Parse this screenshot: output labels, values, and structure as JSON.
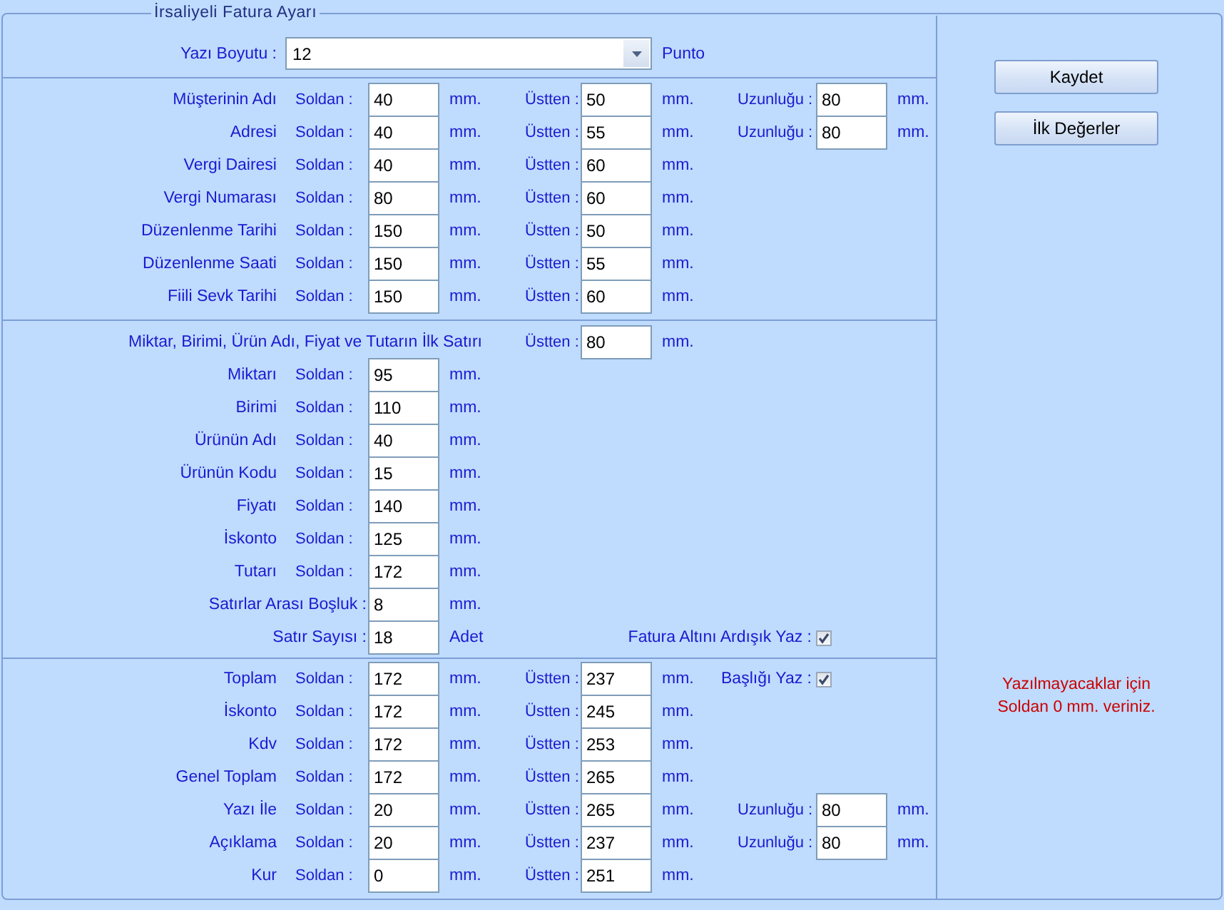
{
  "group_title": "İrsaliyeli Fatura Ayarı",
  "font_size": {
    "label": "Yazı Boyutu :",
    "value": "12",
    "unit": "Punto"
  },
  "sections": [
    {
      "rows": [
        {
          "kind": "row",
          "label": "Müşterinin Adı",
          "left": {
            "label": "Soldan :",
            "value": "40",
            "unit": "mm."
          },
          "top": {
            "label": "Üstten :",
            "value": "50",
            "unit": "mm."
          },
          "length": {
            "label": "Uzunluğu :",
            "value": "80",
            "unit": "mm."
          }
        },
        {
          "kind": "row",
          "label": "Adresi",
          "left": {
            "label": "Soldan :",
            "value": "40",
            "unit": "mm."
          },
          "top": {
            "label": "Üstten :",
            "value": "55",
            "unit": "mm."
          },
          "length": {
            "label": "Uzunluğu :",
            "value": "80",
            "unit": "mm."
          }
        },
        {
          "kind": "row",
          "label": "Vergi Dairesi",
          "left": {
            "label": "Soldan :",
            "value": "40",
            "unit": "mm."
          },
          "top": {
            "label": "Üstten :",
            "value": "60",
            "unit": "mm."
          }
        },
        {
          "kind": "row",
          "label": "Vergi Numarası",
          "left": {
            "label": "Soldan :",
            "value": "80",
            "unit": "mm."
          },
          "top": {
            "label": "Üstten :",
            "value": "60",
            "unit": "mm."
          }
        },
        {
          "kind": "row",
          "label": "Düzenlenme Tarihi",
          "left": {
            "label": "Soldan :",
            "value": "150",
            "unit": "mm."
          },
          "top": {
            "label": "Üstten :",
            "value": "50",
            "unit": "mm."
          }
        },
        {
          "kind": "row",
          "label": "Düzenlenme Saati",
          "left": {
            "label": "Soldan :",
            "value": "150",
            "unit": "mm."
          },
          "top": {
            "label": "Üstten :",
            "value": "55",
            "unit": "mm."
          }
        },
        {
          "kind": "row",
          "label": "Fiili Sevk Tarihi",
          "left": {
            "label": "Soldan :",
            "value": "150",
            "unit": "mm."
          },
          "top": {
            "label": "Üstten :",
            "value": "60",
            "unit": "mm."
          }
        }
      ]
    },
    {
      "rows": [
        {
          "kind": "heading",
          "label": "Miktar, Birimi, Ürün Adı, Fiyat ve Tutarın İlk Satırı",
          "top": {
            "label": "Üstten :",
            "value": "80",
            "unit": "mm."
          }
        },
        {
          "kind": "row",
          "label": "Miktarı",
          "left": {
            "label": "Soldan :",
            "value": "95",
            "unit": "mm."
          }
        },
        {
          "kind": "row",
          "label": "Birimi",
          "left": {
            "label": "Soldan :",
            "value": "110",
            "unit": "mm."
          }
        },
        {
          "kind": "row",
          "label": "Ürünün Adı",
          "left": {
            "label": "Soldan :",
            "value": "40",
            "unit": "mm."
          }
        },
        {
          "kind": "row",
          "label": "Ürünün Kodu",
          "left": {
            "label": "Soldan :",
            "value": "15",
            "unit": "mm."
          }
        },
        {
          "kind": "row",
          "label": "Fiyatı",
          "left": {
            "label": "Soldan :",
            "value": "140",
            "unit": "mm."
          }
        },
        {
          "kind": "row",
          "label": "İskonto",
          "left": {
            "label": "Soldan :",
            "value": "125",
            "unit": "mm."
          }
        },
        {
          "kind": "row",
          "label": "Tutarı",
          "left": {
            "label": "Soldan :",
            "value": "172",
            "unit": "mm."
          }
        },
        {
          "kind": "row",
          "label": "Satırlar Arası Boşluk :",
          "left": {
            "value": "8",
            "unit": "mm."
          }
        },
        {
          "kind": "row",
          "label": "Satır Sayısı :",
          "left": {
            "value": "18",
            "unit": "Adet"
          },
          "check": {
            "label": "Fatura Altını Ardışık Yaz :",
            "checked": true
          }
        }
      ]
    },
    {
      "rows": [
        {
          "kind": "row",
          "label": "Toplam",
          "left": {
            "label": "Soldan :",
            "value": "172",
            "unit": "mm."
          },
          "top": {
            "label": "Üstten :",
            "value": "237",
            "unit": "mm."
          },
          "check": {
            "label": "Başlığı Yaz :",
            "checked": true
          }
        },
        {
          "kind": "row",
          "label": "İskonto",
          "left": {
            "label": "Soldan :",
            "value": "172",
            "unit": "mm."
          },
          "top": {
            "label": "Üstten :",
            "value": "245",
            "unit": "mm."
          }
        },
        {
          "kind": "row",
          "label": "Kdv",
          "left": {
            "label": "Soldan :",
            "value": "172",
            "unit": "mm."
          },
          "top": {
            "label": "Üstten :",
            "value": "253",
            "unit": "mm."
          }
        },
        {
          "kind": "row",
          "label": "Genel Toplam",
          "left": {
            "label": "Soldan :",
            "value": "172",
            "unit": "mm."
          },
          "top": {
            "label": "Üstten :",
            "value": "265",
            "unit": "mm."
          }
        },
        {
          "kind": "row",
          "label": "Yazı İle",
          "left": {
            "label": "Soldan :",
            "value": "20",
            "unit": "mm."
          },
          "top": {
            "label": "Üstten :",
            "value": "265",
            "unit": "mm."
          },
          "length": {
            "label": "Uzunluğu :",
            "value": "80",
            "unit": "mm."
          }
        },
        {
          "kind": "row",
          "label": "Açıklama",
          "left": {
            "label": "Soldan :",
            "value": "20",
            "unit": "mm."
          },
          "top": {
            "label": "Üstten :",
            "value": "237",
            "unit": "mm."
          },
          "length": {
            "label": "Uzunluğu :",
            "value": "80",
            "unit": "mm."
          }
        },
        {
          "kind": "row",
          "label": "Kur",
          "left": {
            "label": "Soldan :",
            "value": "0",
            "unit": "mm."
          },
          "top": {
            "label": "Üstten :",
            "value": "251",
            "unit": "mm."
          }
        }
      ]
    }
  ],
  "buttons": [
    "Kaydet",
    "İlk Değerler"
  ],
  "note": "Yazılmayacaklar için Soldan 0 mm. veriniz."
}
